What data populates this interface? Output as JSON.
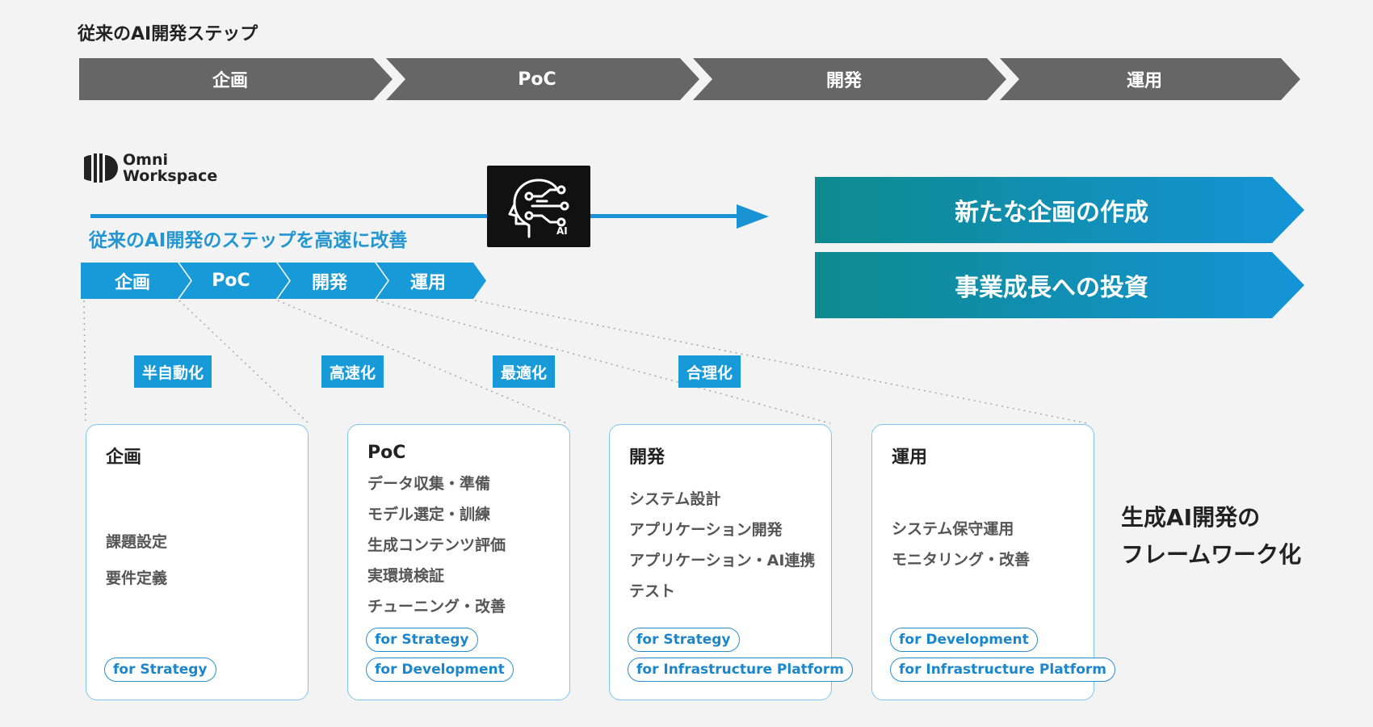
{
  "top_section": {
    "title": "従来のAI開発ステップ",
    "steps": [
      "企画",
      "PoC",
      "開発",
      "運用"
    ]
  },
  "logo": {
    "line1": "Omni",
    "line2": "Workspace"
  },
  "ai_box": {
    "label": "AI",
    "icon": "ai-head-icon"
  },
  "sub_section": {
    "title": "従来のAI開発のステップを高速に改善",
    "steps": [
      "企画",
      "PoC",
      "開発",
      "運用"
    ]
  },
  "outcomes": [
    "新たな企画の作成",
    "事業成長への投資"
  ],
  "badges": [
    "半自動化",
    "高速化",
    "最適化",
    "合理化"
  ],
  "cards": [
    {
      "title": "企画",
      "items": [
        "課題設定",
        "要件定義"
      ],
      "tags": [
        "for Strategy"
      ]
    },
    {
      "title": "PoC",
      "items": [
        "データ収集・準備",
        "モデル選定・訓練",
        "生成コンテンツ評価",
        "実環境検証",
        "チューニング・改善"
      ],
      "tags": [
        "for Strategy",
        "for Development"
      ]
    },
    {
      "title": "開発",
      "items": [
        "システム設計",
        "アプリケーション開発",
        "アプリケーション・AI連携",
        "テスト"
      ],
      "tags": [
        "for Strategy",
        "for Infrastructure Platform"
      ]
    },
    {
      "title": "運用",
      "items": [
        "システム保守運用",
        "モニタリング・改善"
      ],
      "tags": [
        "for Development",
        "for Infrastructure Platform"
      ]
    }
  ],
  "framework": {
    "line1": "生成AI開発の",
    "line2": "フレームワーク化"
  },
  "colors": {
    "grey_step": "#666666",
    "blue": "#189ad8",
    "teal_start": "#0e8a8e",
    "teal_end": "#1494d8",
    "card_border": "#7cc6ec"
  }
}
